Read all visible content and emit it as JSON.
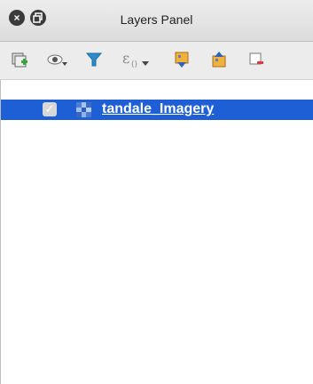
{
  "window": {
    "title": "Layers Panel",
    "close_icon": "close-icon",
    "restore_icon": "restore-icon"
  },
  "toolbar": {
    "tools": [
      {
        "icon": "add-group-icon"
      },
      {
        "icon": "manage-visibility-icon"
      },
      {
        "icon": "filter-legend-icon"
      },
      {
        "icon": "filter-expression-icon"
      },
      {
        "icon": "expand-all-icon"
      },
      {
        "icon": "collapse-all-icon"
      },
      {
        "icon": "remove-layer-icon"
      }
    ]
  },
  "layers": [
    {
      "name": "tandale_Imagery",
      "checked": true,
      "type": "raster"
    }
  ],
  "colors": {
    "selection": "#1f5fd6",
    "checkbox": "#d8d8d8"
  }
}
